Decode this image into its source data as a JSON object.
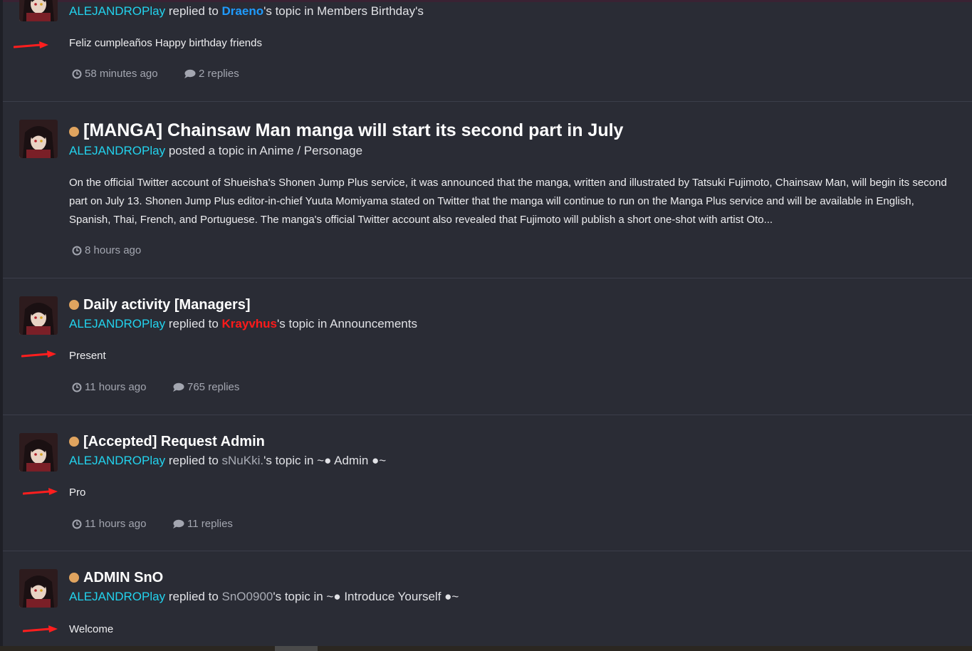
{
  "items": [
    {
      "title": "",
      "author": "ALEJANDROPlay",
      "action": "replied to",
      "target_user": "Draeno",
      "suffix": "'s topic in Members Birthday's",
      "excerpt": "Feliz cumpleaños Happy birthday friends",
      "time": "58 minutes ago",
      "replies": "2 replies"
    },
    {
      "title": "[MANGA] Chainsaw Man manga will start its second part in July",
      "author": "ALEJANDROPlay",
      "action": "posted a topic in Anime / Personage",
      "excerpt": "On the official Twitter account of Shueisha's Shonen Jump Plus service, it was announced that the manga, written and illustrated by Tatsuki Fujimoto, Chainsaw Man, will begin its second part on July 13. Shonen Jump Plus editor-in-chief Yuuta Momiyama stated on Twitter that the manga will continue to run on the Manga Plus service and will be available in English, Spanish, Thai, French, and Portuguese. The manga's official Twitter account also revealed that Fujimoto will publish a short one-shot with artist Oto...",
      "time": "8 hours ago"
    },
    {
      "title": "Daily activity [Managers]",
      "author": "ALEJANDROPlay",
      "action": "replied to",
      "target_user": "Krayvhus",
      "suffix": "'s topic in Announcements",
      "excerpt": "Present",
      "time": "11 hours ago",
      "replies": "765 replies"
    },
    {
      "title": "[Accepted] Request Admin",
      "author": "ALEJANDROPlay",
      "action": "replied to",
      "target_user": "sNuKki.",
      "suffix": "'s topic in ~● Admin ●~",
      "excerpt": "Pro",
      "time": "11 hours ago",
      "replies": "11 replies"
    },
    {
      "title": "ADMIN SnO",
      "author": "ALEJANDROPlay",
      "action": "replied to",
      "target_user": "SnO0900",
      "suffix": "'s topic in ~● Introduce Yourself ●~",
      "excerpt": "Welcome"
    }
  ],
  "colors": {
    "background": "#2a2c35",
    "author": "#22d3ee",
    "user_blue": "#1f9bff",
    "user_red": "#ff1a1a",
    "unread_dot": "#e0a45f",
    "arrow": "#ff1e1e",
    "muted": "#a3a6b0"
  },
  "icons": [
    "clock-icon",
    "comment-icon",
    "red-arrow-annotation",
    "unread-dot-icon",
    "avatar"
  ]
}
